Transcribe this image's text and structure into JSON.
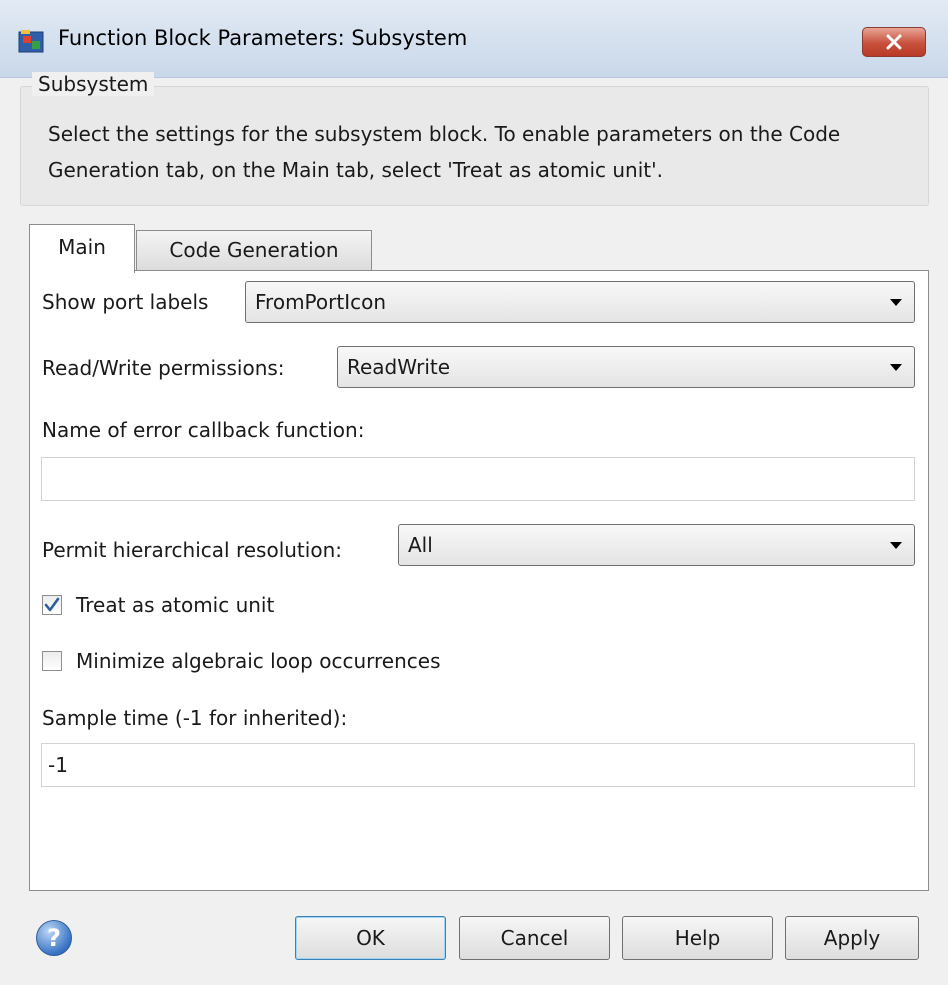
{
  "window": {
    "title": "Function Block Parameters: Subsystem"
  },
  "group": {
    "title": "Subsystem",
    "description": "Select the settings for the subsystem block. To enable parameters on the Code Generation tab, on the Main tab, select 'Treat as atomic unit'."
  },
  "tabs": [
    {
      "label": "Main",
      "selected": true
    },
    {
      "label": "Code Generation",
      "selected": false
    }
  ],
  "main": {
    "show_port_labels": {
      "label": "Show port labels",
      "value": "FromPortIcon"
    },
    "rw_permissions": {
      "label": "Read/Write permissions:",
      "value": "ReadWrite"
    },
    "error_callback": {
      "label": "Name of error callback function:",
      "value": ""
    },
    "hierarchical_resolution": {
      "label": "Permit hierarchical resolution:",
      "value": "All"
    },
    "treat_atomic": {
      "label": "Treat as atomic unit",
      "checked": true
    },
    "minimize_loop": {
      "label": "Minimize algebraic loop occurrences",
      "checked": false
    },
    "sample_time": {
      "label": "Sample time (-1 for inherited):",
      "value": "-1"
    }
  },
  "buttons": {
    "ok": "OK",
    "cancel": "Cancel",
    "help": "Help",
    "apply": "Apply"
  },
  "icons": {
    "app": "simulink-block-icon",
    "close": "close-icon",
    "help": "help-icon",
    "dropdown": "chevron-down-icon",
    "check": "checkmark-icon"
  },
  "colors": {
    "titlebar": "#c9d8ea",
    "close_button": "#c8503c",
    "dialog_bg": "#f0f0f0",
    "panel_bg": "#ffffff",
    "check_mark": "#2f5e9e"
  }
}
